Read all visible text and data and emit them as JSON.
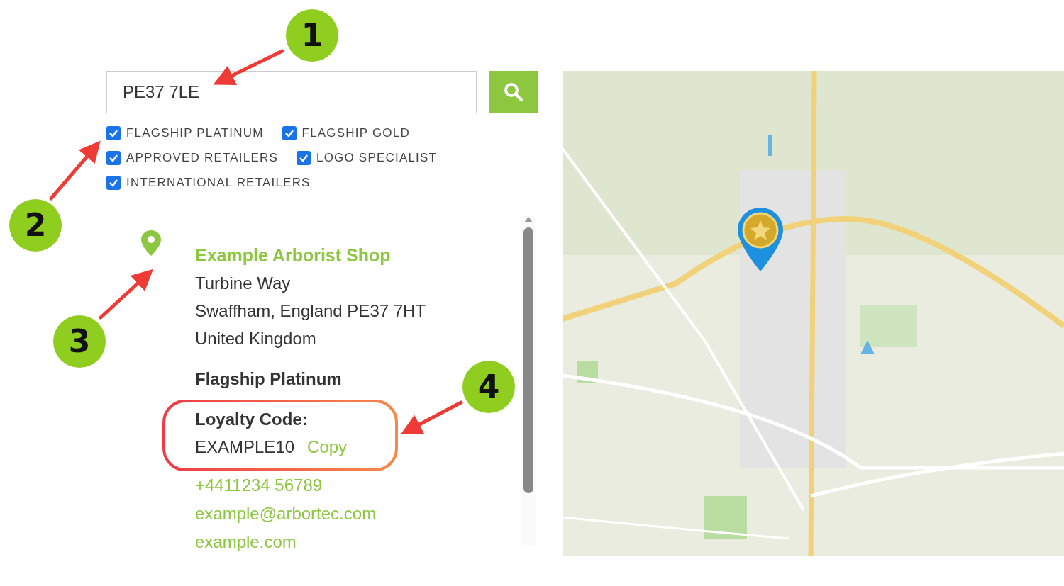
{
  "search": {
    "value": "PE37 7LE"
  },
  "filters": [
    {
      "label": "FLAGSHIP PLATINUM",
      "checked": true
    },
    {
      "label": "FLAGSHIP GOLD",
      "checked": true
    },
    {
      "label": "APPROVED RETAILERS",
      "checked": true
    },
    {
      "label": "LOGO SPECIALIST",
      "checked": true
    },
    {
      "label": "INTERNATIONAL RETAILERS",
      "checked": true
    }
  ],
  "result": {
    "name": "Example Arborist Shop",
    "address": [
      "Turbine Way",
      "Swaffham, England PE37 7HT",
      "United Kingdom"
    ],
    "tier": "Flagship Platinum",
    "loyalty_label": "Loyalty Code:",
    "loyalty_code": "EXAMPLE10",
    "copy": "Copy",
    "phone": "+4411234 56789",
    "email": "example@arbortec.com",
    "website": "example.com"
  },
  "annotations": [
    {
      "number": "1"
    },
    {
      "number": "2"
    },
    {
      "number": "3"
    },
    {
      "number": "4"
    }
  ]
}
